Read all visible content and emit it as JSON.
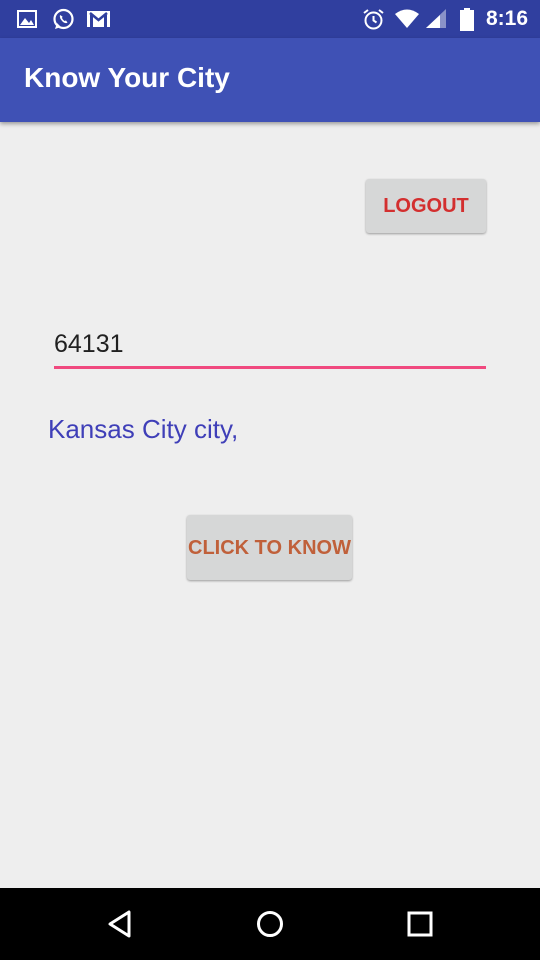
{
  "status_bar": {
    "time": "8:16",
    "icons": [
      "image-icon",
      "whatsapp-icon",
      "gmail-icon",
      "alarm-icon",
      "wifi-icon",
      "signal-icon",
      "battery-icon"
    ]
  },
  "app_bar": {
    "title": "Know Your City"
  },
  "logout_button": {
    "label": "LOGOUT"
  },
  "zip_input": {
    "value": "64131"
  },
  "result": {
    "text": "Kansas City city,"
  },
  "know_button": {
    "label": "CLICK TO KNOW"
  },
  "nav_bar": {
    "buttons": [
      "back-icon",
      "home-icon",
      "recents-icon"
    ]
  },
  "colors": {
    "status_bar": "#303f9f",
    "app_bar": "#3f51b5",
    "accent": "#f0497f",
    "logout_text": "#d32f2f",
    "know_text": "#c0603a",
    "result_text": "#3f3fb8"
  }
}
